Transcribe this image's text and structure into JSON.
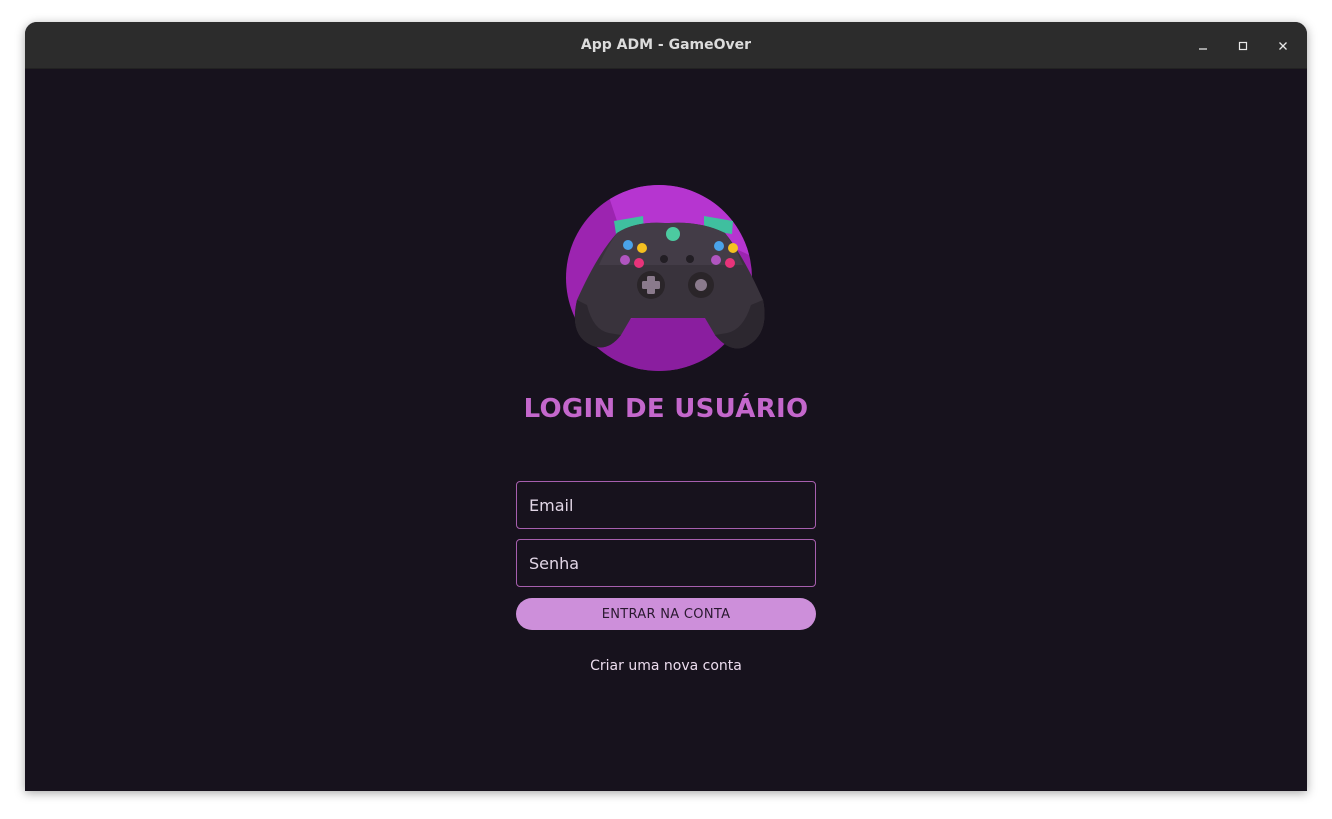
{
  "window": {
    "title": "App ADM - GameOver",
    "controls": {
      "minimize_icon": "minimize-icon",
      "maximize_icon": "maximize-icon",
      "close_icon": "close-icon"
    }
  },
  "login": {
    "logo_icon": "gamepad-icon",
    "title": "LOGIN DE USUÁRIO",
    "email_placeholder": "Email",
    "email_value": "",
    "password_placeholder": "Senha",
    "password_value": "",
    "submit_label": "ENTRAR NA CONTA",
    "create_account_label": "Criar uma nova conta"
  },
  "colors": {
    "background": "#17121d",
    "titlebar": "#2c2c2c",
    "accent": "#c467cc",
    "button": "#cd8fda",
    "field_border": "#a75fae"
  }
}
